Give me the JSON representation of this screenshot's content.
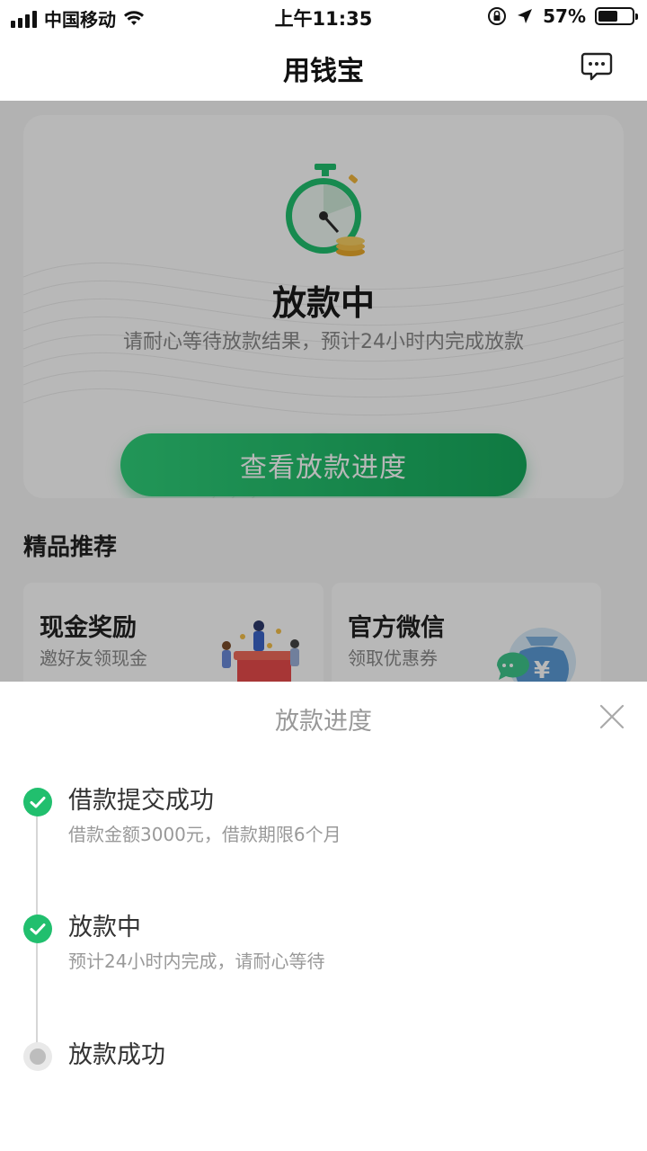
{
  "status_bar": {
    "carrier": "中国移动",
    "time": "上午11:35",
    "battery": "57%",
    "battery_level": 0.57
  },
  "nav": {
    "title": "用钱宝"
  },
  "loan_status": {
    "title": "放款中",
    "description": "请耐心等待放款结果，预计24小时内完成放款",
    "button_label": "查看放款进度"
  },
  "recommend": {
    "section_title": "精品推荐",
    "items": [
      {
        "title": "现金奖励",
        "subtitle": "邀好友领现金"
      },
      {
        "title": "官方微信",
        "subtitle": "领取优惠券"
      }
    ]
  },
  "sheet": {
    "title": "放款进度",
    "steps": [
      {
        "title": "借款提交成功",
        "desc": "借款金额3000元，借款期限6个月",
        "status": "done"
      },
      {
        "title": "放款中",
        "desc": "预计24小时内完成，请耐心等待",
        "status": "done"
      },
      {
        "title": "放款成功",
        "desc": "",
        "status": "pending"
      }
    ]
  },
  "colors": {
    "accent_green": "#21bf6e",
    "button_gradient_start": "#2fd07a",
    "button_gradient_end": "#16a95c"
  }
}
